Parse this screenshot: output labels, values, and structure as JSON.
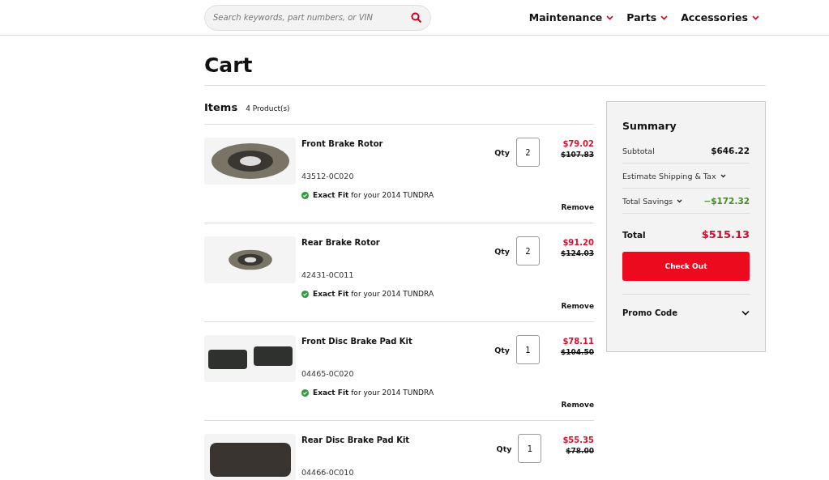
{
  "header": {
    "search": {
      "placeholder": "Search keywords, part numbers, or VIN"
    },
    "nav": [
      "Maintenance",
      "Parts",
      "Accessories"
    ]
  },
  "title": "Cart",
  "items_heading": {
    "label": "Items",
    "count": "4 Product(s)"
  },
  "items": [
    {
      "name": "Front Brake Rotor",
      "part": "43512-0C020",
      "fit": {
        "label": "Exact Fit",
        "text": "for your  2014 TUNDRA"
      },
      "qty_label": "Qty",
      "qty": "2",
      "price": "$79.02",
      "old_price": "$107.83",
      "remove": "Remove",
      "kind": "rotor"
    },
    {
      "name": "Rear Brake Rotor",
      "part": "42431-0C011",
      "fit": {
        "label": "Exact Fit",
        "text": "for your  2014 TUNDRA"
      },
      "qty_label": "Qty",
      "qty": "2",
      "price": "$91.20",
      "old_price": "$124.03",
      "remove": "Remove",
      "kind": "rotor"
    },
    {
      "name": "Front Disc Brake Pad Kit",
      "part": "04465-0C020",
      "fit": {
        "label": "Exact Fit",
        "text": "for your  2014 TUNDRA"
      },
      "qty_label": "Qty",
      "qty": "1",
      "price": "$78.11",
      "old_price": "$104.50",
      "remove": "Remove",
      "kind": "pads"
    },
    {
      "name": "Rear Disc Brake Pad Kit",
      "part": "04466-0C010",
      "qty_label": "Qty",
      "qty": "1",
      "price": "$55.35",
      "old_price": "$78.00",
      "kind": "pad"
    }
  ],
  "summary": {
    "title": "Summary",
    "rows": [
      {
        "label": "Subtotal",
        "value": "$646.22",
        "kind": "plain"
      },
      {
        "label": "Estimate Shipping & Tax",
        "kind": "dropdown"
      },
      {
        "label": "Total Savings",
        "value": "−$172.32",
        "kind": "savings"
      }
    ],
    "total_label": "Total",
    "total": "$515.13",
    "checkout": "Check Out",
    "promo": "Promo Code"
  }
}
